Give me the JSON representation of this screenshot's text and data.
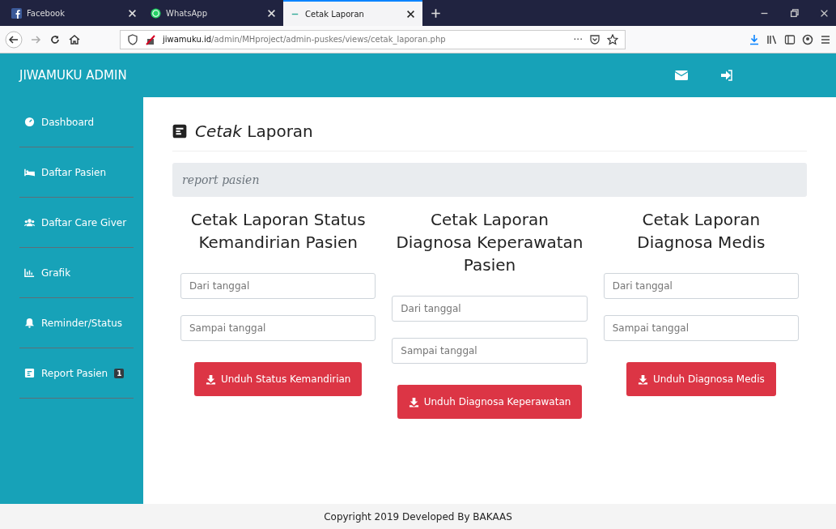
{
  "browser": {
    "tabs": [
      {
        "title": "Facebook",
        "kind": "facebook",
        "selected": false
      },
      {
        "title": "WhatsApp",
        "kind": "whatsapp",
        "selected": false
      },
      {
        "title": "Cetak Laporan",
        "kind": "page",
        "selected": true
      }
    ],
    "url_host": "jiwamuku.id",
    "url_path": "/admin/MHproject/admin-puskes/views/cetak_laporan.php",
    "more": "···"
  },
  "topbar": {
    "brand": "JIWAMUKU ADMIN"
  },
  "sidebar": {
    "items": [
      {
        "label": "Dashboard",
        "kind": "dashboard"
      },
      {
        "label": "Daftar Pasien",
        "kind": "bed"
      },
      {
        "label": "Daftar Care Giver",
        "kind": "users"
      },
      {
        "label": "Grafik",
        "kind": "chart"
      },
      {
        "label": "Reminder/Status",
        "kind": "bell"
      },
      {
        "label": "Report Pasien",
        "kind": "report",
        "badge": "1"
      }
    ]
  },
  "page": {
    "title": "*Cetak* Laporan",
    "breadcrumb": "report pasien",
    "reports": [
      {
        "heading": "Cetak Laporan Status Kemandirian Pasien",
        "from_placeholder": "Dari tanggal",
        "to_placeholder": "Sampai tanggal",
        "button": "Unduh Status Kemandirian"
      },
      {
        "heading": "Cetak Laporan Diagnosa Keperawatan Pasien",
        "from_placeholder": "Dari tanggal",
        "to_placeholder": "Sampai tanggal",
        "button": "Unduh Diagnosa Keperawatan"
      },
      {
        "heading": "Cetak Laporan Diagnosa Medis",
        "from_placeholder": "Dari tanggal",
        "to_placeholder": "Sampai tanggal",
        "button": "Unduh Diagnosa Medis"
      }
    ]
  },
  "footer": "Copyright 2019 Developed By BAKAAS"
}
